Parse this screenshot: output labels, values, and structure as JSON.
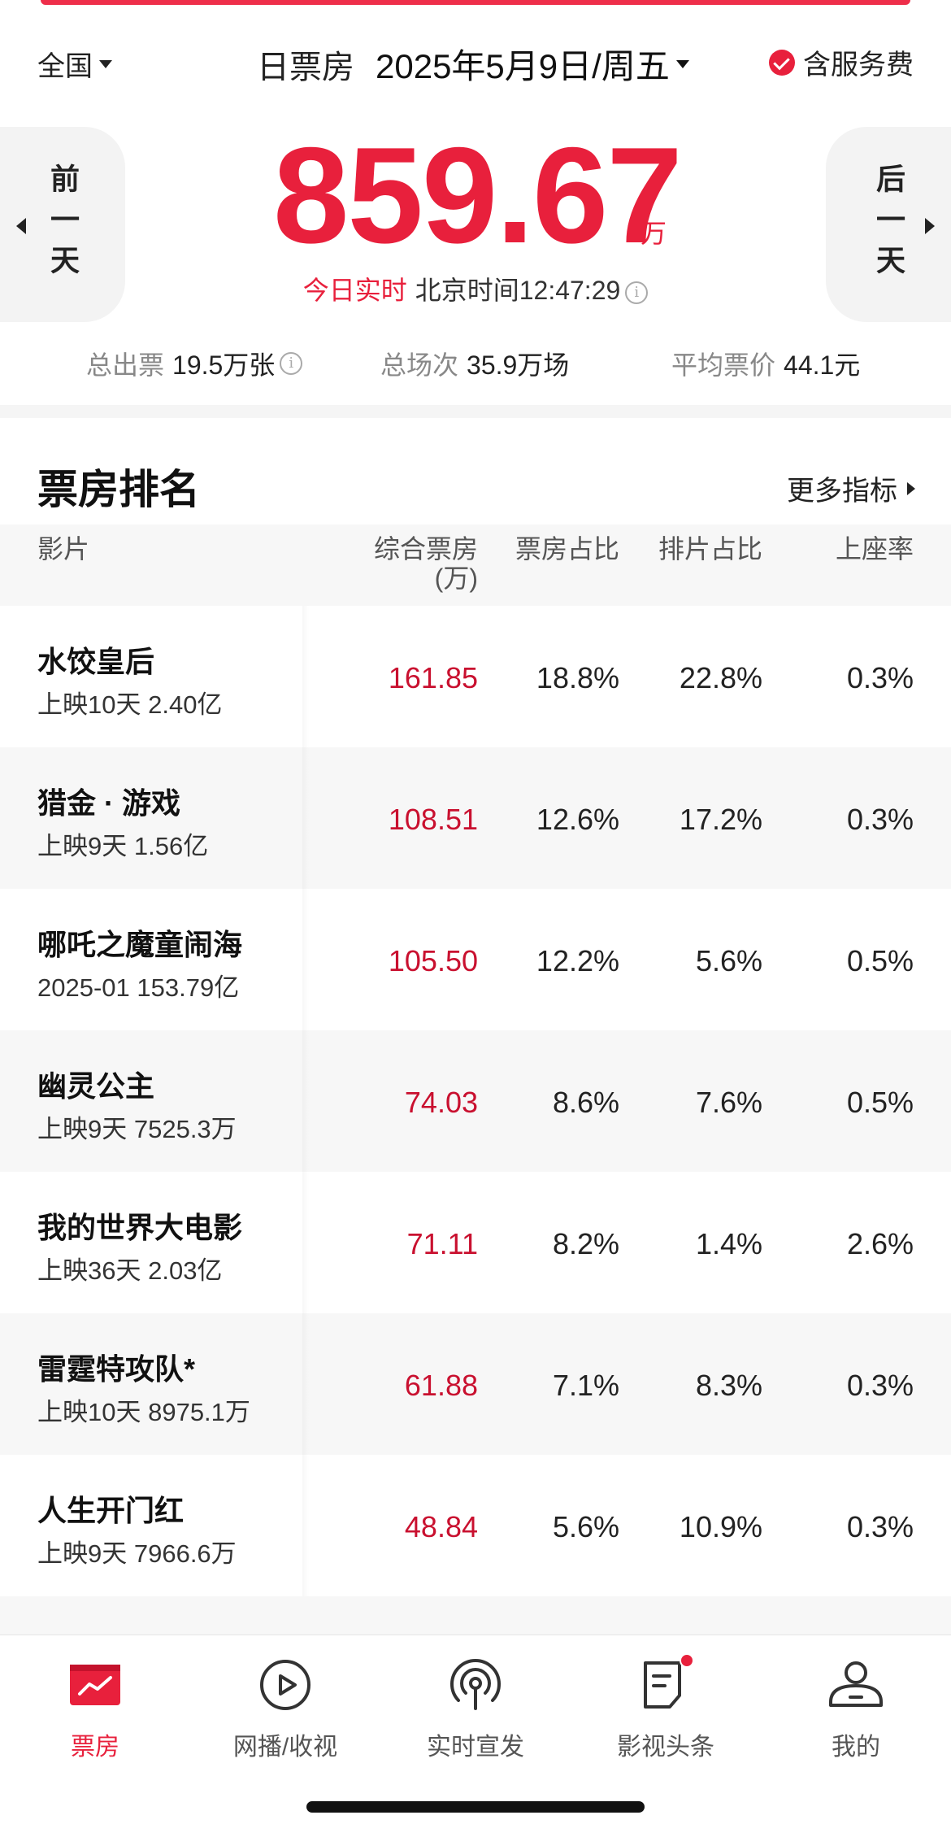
{
  "header": {
    "region": "全国",
    "board_type": "日票房",
    "date": "2025年5月9日/周五",
    "fee_label": "含服务费"
  },
  "total": {
    "prev_label": "前一天",
    "next_label": "后一天",
    "value": "859.67",
    "unit": "万",
    "realtime_label": "今日实时",
    "time_text": "北京时间12:47:29"
  },
  "stats": [
    {
      "label": "总出票",
      "value": "19.5万张"
    },
    {
      "label": "总场次",
      "value": "35.9万场"
    },
    {
      "label": "平均票价",
      "value": "44.1元"
    }
  ],
  "ranking": {
    "title": "票房排名",
    "more_label": "更多指标",
    "columns": {
      "film": "影片",
      "box_line1": "综合票房",
      "box_line2": "(万)",
      "share": "票房占比",
      "schedule": "排片占比",
      "seat": "上座率"
    },
    "rows": [
      {
        "name": "水饺皇后",
        "sub": "上映10天 2.40亿",
        "box": "161.85",
        "share": "18.8%",
        "schedule": "22.8%",
        "seat": "0.3%"
      },
      {
        "name": "猎金 · 游戏",
        "sub": "上映9天 1.56亿",
        "box": "108.51",
        "share": "12.6%",
        "schedule": "17.2%",
        "seat": "0.3%"
      },
      {
        "name": "哪吒之魔童闹海",
        "sub": "2025-01 153.79亿",
        "box": "105.50",
        "share": "12.2%",
        "schedule": "5.6%",
        "seat": "0.5%"
      },
      {
        "name": "幽灵公主",
        "sub": "上映9天 7525.3万",
        "box": "74.03",
        "share": "8.6%",
        "schedule": "7.6%",
        "seat": "0.5%"
      },
      {
        "name": "我的世界大电影",
        "sub": "上映36天 2.03亿",
        "box": "71.11",
        "share": "8.2%",
        "schedule": "1.4%",
        "seat": "2.6%"
      },
      {
        "name": "雷霆特攻队*",
        "sub": "上映10天 8975.1万",
        "box": "61.88",
        "share": "7.1%",
        "schedule": "8.3%",
        "seat": "0.3%"
      },
      {
        "name": "人生开门红",
        "sub": "上映9天 7966.6万",
        "box": "48.84",
        "share": "5.6%",
        "schedule": "10.9%",
        "seat": "0.3%"
      }
    ]
  },
  "nav": [
    {
      "label": "票房",
      "icon": "box-office-chart-icon",
      "active": true
    },
    {
      "label": "网播/收视",
      "icon": "play-circle-icon",
      "active": false
    },
    {
      "label": "实时宣发",
      "icon": "broadcast-icon",
      "active": false
    },
    {
      "label": "影视头条",
      "icon": "news-document-icon",
      "active": false
    },
    {
      "label": "我的",
      "icon": "user-profile-icon",
      "active": false
    }
  ],
  "colors": {
    "accent": "#e8203c",
    "box_value": "#c9102f"
  }
}
